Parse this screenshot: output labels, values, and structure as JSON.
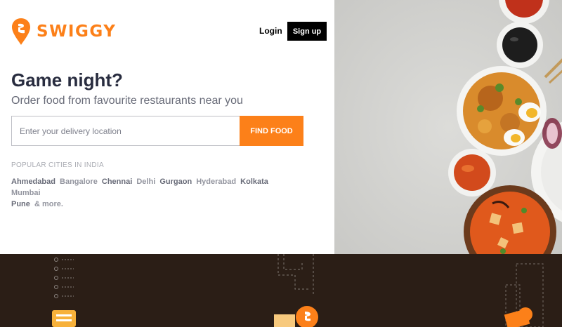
{
  "header": {
    "brand": "SWIGGY",
    "login_label": "Login",
    "signup_label": "Sign up"
  },
  "hero": {
    "headline": "Game night?",
    "subline": "Order food from favourite restaurants near you",
    "search": {
      "placeholder": "Enter your delivery location",
      "value": "",
      "button_label": "FIND FOOD"
    },
    "popular": {
      "label": "POPULAR CITIES IN INDIA",
      "cities": [
        "Ahmedabad",
        "Bangalore",
        "Chennai",
        "Delhi",
        "Gurgaon",
        "Hyderabad",
        "Kolkata",
        "Mumbai",
        "Pune"
      ],
      "more_label": "& more."
    }
  },
  "colors": {
    "brand": "#fc8019",
    "footer_band": "#2b1e16",
    "heading": "#282c3f"
  },
  "icons": {
    "logo": "swiggy-logo-icon"
  }
}
